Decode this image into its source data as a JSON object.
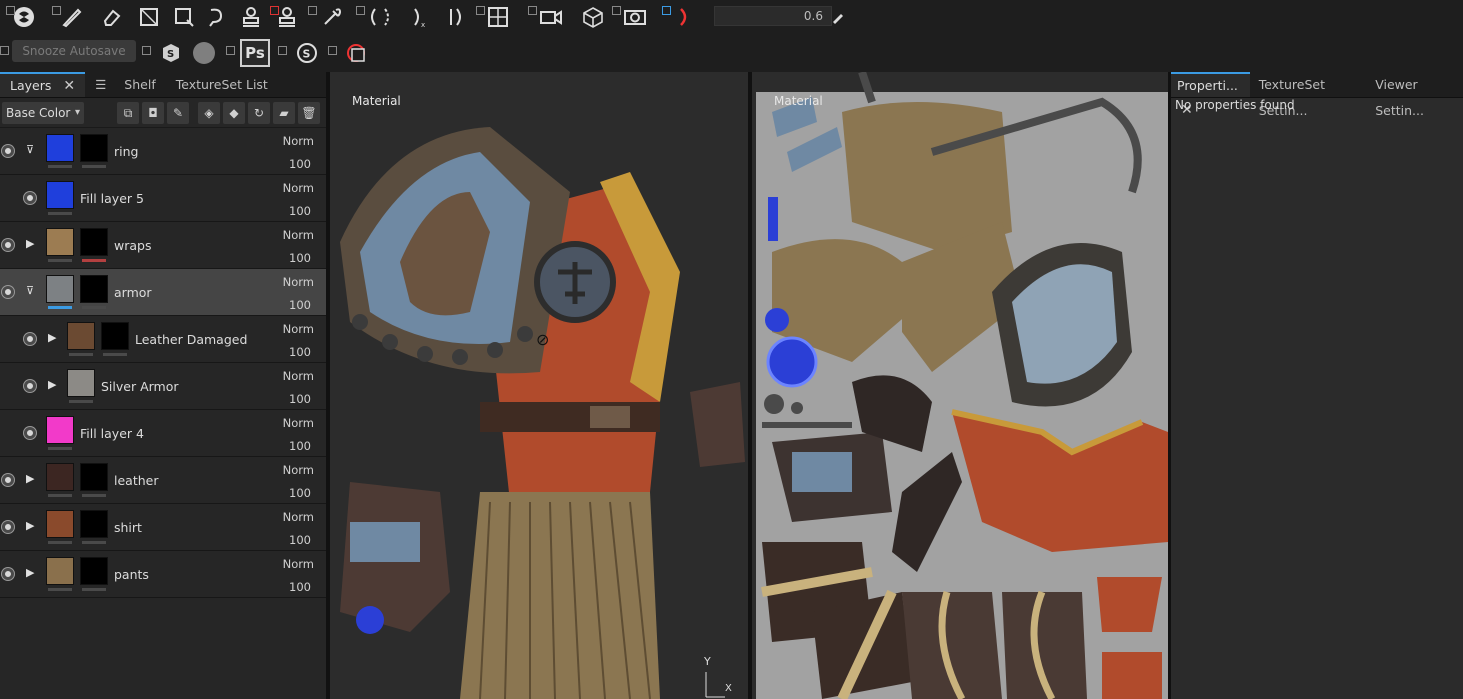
{
  "toolbar": {
    "tools": [
      "paint-brush-icon",
      "eraser-icon",
      "projection-icon",
      "polygon-fill-icon",
      "smudge-icon",
      "clone-stamp-icon",
      "material-picker-icon",
      "color-picker-icon",
      "symmetry-icon",
      "symmetry-x-icon",
      "symmetry-mirror-icon",
      "viewport-split-icon",
      "camera-icon",
      "cube-icon",
      "screenshot-icon",
      "iray-icon"
    ],
    "brush_opacity": "0.6",
    "snooze_label": "Snooze Autosave",
    "ps_label": "Ps"
  },
  "layers_panel": {
    "tabs": [
      {
        "label": "Layers"
      },
      {
        "label": "Shelf"
      },
      {
        "label": "TextureSet List"
      }
    ],
    "channel": "Base Color",
    "layers": [
      {
        "name": "ring",
        "blend": "Norm",
        "opacity": "100",
        "type": "folder-open",
        "color": "#1f3fdc",
        "mask": "#000000"
      },
      {
        "name": "Fill layer 5",
        "blend": "Norm",
        "opacity": "100",
        "type": "fill",
        "color": "#1f3fdc"
      },
      {
        "name": "wraps",
        "blend": "Norm",
        "opacity": "100",
        "type": "folder",
        "color": "#9c7c52",
        "mask": "#000000"
      },
      {
        "name": "armor",
        "blend": "Norm",
        "opacity": "100",
        "type": "folder-open",
        "color": "#7d8184",
        "mask": "#000000",
        "selected": true
      },
      {
        "name": "Leather Damaged",
        "blend": "Norm",
        "opacity": "100",
        "type": "sub-folder",
        "color": "#6b4a32",
        "mask": "#000000"
      },
      {
        "name": "Silver Armor",
        "blend": "Norm",
        "opacity": "100",
        "type": "sub-folder",
        "color": "#8c8a86"
      },
      {
        "name": "Fill layer 4",
        "blend": "Norm",
        "opacity": "100",
        "type": "fill",
        "color": "#f23ac9"
      },
      {
        "name": "leather",
        "blend": "Norm",
        "opacity": "100",
        "type": "folder",
        "color": "#3c2622",
        "mask": "#000000"
      },
      {
        "name": "shirt",
        "blend": "Norm",
        "opacity": "100",
        "type": "folder",
        "color": "#8a4a2c",
        "mask": "#000000"
      },
      {
        "name": "pants",
        "blend": "Norm",
        "opacity": "100",
        "type": "folder",
        "color": "#8a704c",
        "mask": "#000000"
      }
    ]
  },
  "viewport_3d": {
    "label": "Material",
    "axis_y": "Y",
    "axis_x": "X"
  },
  "viewport_2d": {
    "label": "Material"
  },
  "properties_panel": {
    "tabs": [
      {
        "label": "Properti..."
      },
      {
        "label": "TextureSet Settin..."
      },
      {
        "label": "Viewer Settin..."
      }
    ],
    "empty_text": "No properties found"
  }
}
